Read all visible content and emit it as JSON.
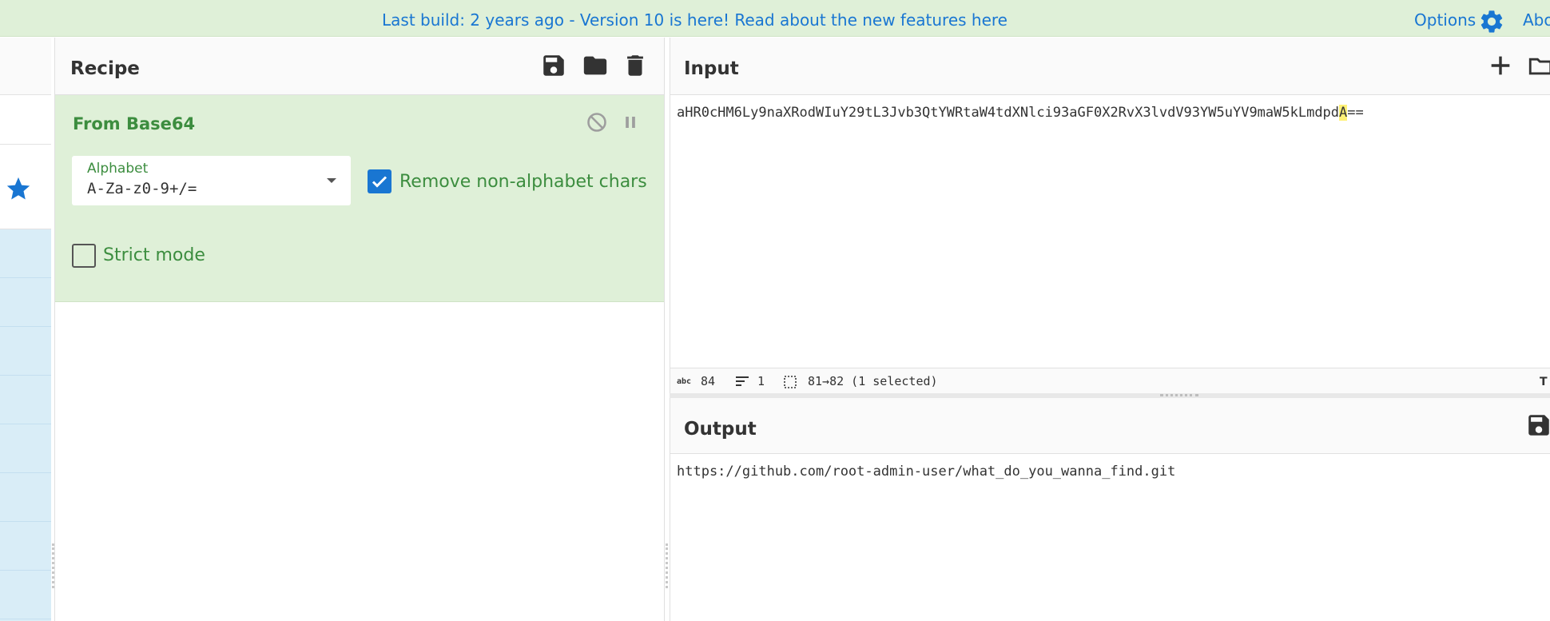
{
  "banner": {
    "message": "Last build: 2 years ago - Version 10 is here! Read about the new features here",
    "options_label": "Options",
    "about_label": "Abo",
    "link_color": "#1976d2"
  },
  "recipe": {
    "title": "Recipe",
    "operation": {
      "name": "From Base64",
      "alphabet_label": "Alphabet",
      "alphabet_value": "A-Za-z0-9+/=",
      "remove_non_alphabet_label": "Remove non-alphabet chars",
      "remove_non_alphabet_checked": true,
      "strict_mode_label": "Strict mode",
      "strict_mode_checked": false
    }
  },
  "input": {
    "title": "Input",
    "text_before": "aHR0cHM6Ly9naXRodWIuY29tL3Jvb3QtYWRtaW4tdXNlci93aGF0X2RvX3lvdV93YW5uYV9maW5kLmdpd",
    "text_selected": "A",
    "text_after": "==",
    "status": {
      "chars": "84",
      "lines": "1",
      "selection": "81→82 (1 selected)"
    }
  },
  "output": {
    "title": "Output",
    "text": "https://github.com/root-admin-user/what_do_you_wanna_find.git"
  },
  "icons": {
    "options": "gear-icon",
    "favourites": "star-icon",
    "save_recipe": "save-icon",
    "load_recipe": "folder-icon",
    "clear_recipe": "trash-icon",
    "disable_op": "disable-icon",
    "pause_op": "pause-icon",
    "add_input": "plus-icon",
    "open_input": "folder-icon",
    "save_output": "save-icon"
  },
  "colors": {
    "banner_bg": "#dff0d8",
    "op_bg": "#dff0d8",
    "op_text": "#3c8d3f",
    "accent": "#1976d2",
    "category_bg": "#d9edf7",
    "highlight": "#fff176"
  }
}
